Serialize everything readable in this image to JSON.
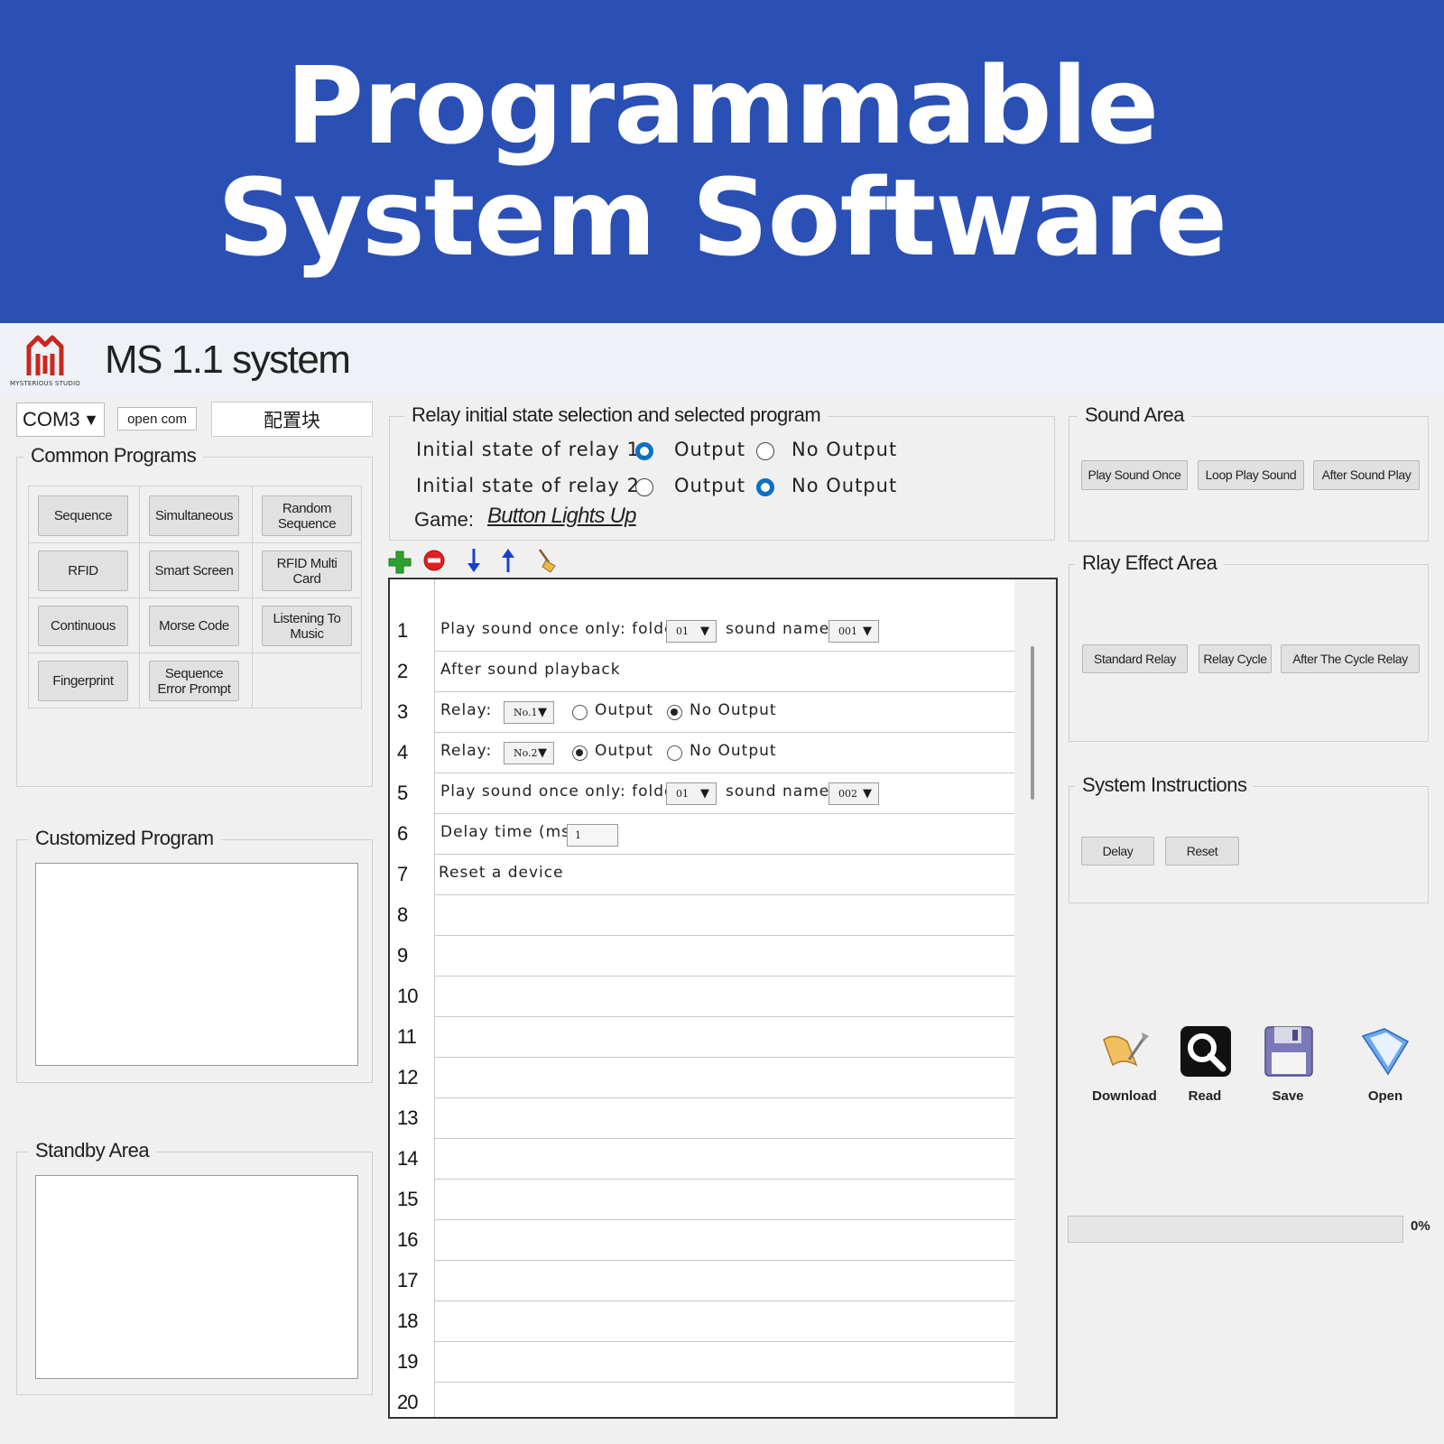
{
  "banner": {
    "line1": "Programmable",
    "line2": "System Software"
  },
  "app": {
    "title": "MS 1.1 system",
    "logo_caption": "MYSTERIOUS STUDIO",
    "brand_color": "#c8281e"
  },
  "connection": {
    "port": "COM3",
    "open_button": "open com",
    "config_button": "配置块"
  },
  "common_programs": {
    "label": "Common Programs",
    "items": [
      "Sequence",
      "Simultaneous",
      "Random Sequence",
      "RFID",
      "Smart Screen",
      "RFID Multi Card",
      "Continuous",
      "Morse Code",
      "Listening To Music",
      "Fingerprint",
      "Sequence Error Prompt"
    ]
  },
  "customized_program": {
    "label": "Customized Program"
  },
  "standby_area": {
    "label": "Standby Area"
  },
  "relay_state": {
    "label": "Relay initial state selection and selected program",
    "relay1_label": "Initial state of relay 1",
    "relay2_label": "Initial state of relay 2",
    "output_label": "Output",
    "no_output_label": "No Output",
    "relay1_selected": "Output",
    "relay2_selected": "No Output",
    "game_label": "Game:",
    "game_value": "Button Lights Up"
  },
  "toolbar": {
    "icons": [
      "add-icon",
      "remove-icon",
      "move-down-icon",
      "move-up-icon",
      "clear-broom-icon"
    ]
  },
  "program_table": {
    "row_numbers": [
      "1",
      "2",
      "3",
      "4",
      "5",
      "6",
      "7",
      "8",
      "9",
      "10",
      "11",
      "12",
      "13",
      "14",
      "15",
      "16",
      "17",
      "18",
      "19",
      "20"
    ],
    "row1": {
      "label": "Play sound once only: folder",
      "folder": "01",
      "sound_label": "sound name",
      "sound": "001"
    },
    "row2": {
      "label": "After sound playback"
    },
    "row3": {
      "label": "Relay:",
      "relay": "No.1",
      "output": "Output",
      "no_output": "No Output",
      "selected": "No Output"
    },
    "row4": {
      "label": "Relay:",
      "relay": "No.2",
      "output": "Output",
      "no_output": "No Output",
      "selected": "Output"
    },
    "row5": {
      "label": "Play sound once only: folder",
      "folder": "01",
      "sound_label": "sound name",
      "sound": "002"
    },
    "row6": {
      "label": "Delay time (ms)",
      "value": "1"
    },
    "row7": {
      "label": "Reset a device"
    }
  },
  "sound_area": {
    "label": "Sound Area",
    "buttons": [
      "Play Sound Once",
      "Loop Play Sound",
      "After Sound Play"
    ]
  },
  "relay_effect_area": {
    "label": "Rlay Effect Area",
    "buttons": [
      "Standard Relay",
      "Relay Cycle",
      "After The Cycle Relay"
    ]
  },
  "system_instructions": {
    "label": "System Instructions",
    "buttons": [
      "Delay",
      "Reset"
    ]
  },
  "actions": {
    "download": "Download",
    "read": "Read",
    "save": "Save",
    "open": "Open"
  },
  "progress": {
    "value": 0,
    "text": "0%"
  },
  "colors": {
    "banner": "#2a4fb5",
    "radio_selected": "#0c6fc7",
    "window_bg": "#f0f0f0"
  }
}
